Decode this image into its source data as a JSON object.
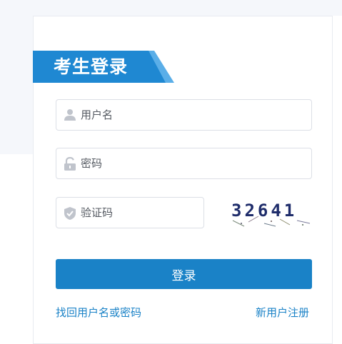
{
  "panel": {
    "title": "考生登录"
  },
  "form": {
    "username_placeholder": "用户名",
    "password_placeholder": "密码",
    "captcha_placeholder": "验证码",
    "captcha_value": "32641"
  },
  "actions": {
    "login_label": "登录",
    "recover_link": "找回用户名或密码",
    "register_link": "新用户注册"
  },
  "icons": {
    "username": "user-icon",
    "password": "lock-icon",
    "captcha": "shield-check-icon"
  },
  "colors": {
    "accent": "#1a82c7",
    "tab": "#2a8fd6",
    "icon": "#c0c4cc"
  }
}
